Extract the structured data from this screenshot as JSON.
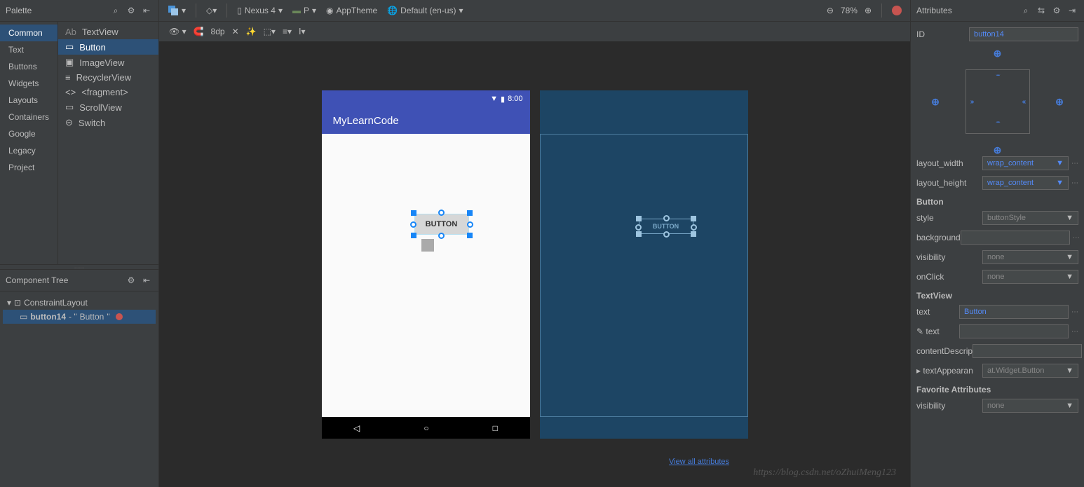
{
  "palette": {
    "title": "Palette",
    "categories": [
      "Common",
      "Text",
      "Buttons",
      "Widgets",
      "Layouts",
      "Containers",
      "Google",
      "Legacy",
      "Project"
    ],
    "selectedCategory": "Common",
    "items": [
      "TextView",
      "Button",
      "ImageView",
      "RecyclerView",
      "<fragment>",
      "ScrollView",
      "Switch"
    ],
    "selectedItem": "Button"
  },
  "componentTree": {
    "title": "Component Tree",
    "root": "ConstraintLayout",
    "child": {
      "id": "button14",
      "text": "Button"
    }
  },
  "toolbar": {
    "device": "Nexus 4",
    "api": "P",
    "theme": "AppTheme",
    "locale": "Default (en-us)",
    "zoom": "78%",
    "margin": "8dp"
  },
  "device": {
    "time": "8:00",
    "appTitle": "MyLearnCode",
    "buttonLabel": "BUTTON"
  },
  "blueprint": {
    "buttonLabel": "BUTTON"
  },
  "viewAll": "View all attributes",
  "attributes": {
    "title": "Attributes",
    "id": {
      "label": "ID",
      "value": "button14"
    },
    "layout_width": {
      "label": "layout_width",
      "value": "wrap_content"
    },
    "layout_height": {
      "label": "layout_height",
      "value": "wrap_content"
    },
    "sections": {
      "button": "Button",
      "textview": "TextView",
      "favorite": "Favorite Attributes"
    },
    "style": {
      "label": "style",
      "value": "buttonStyle"
    },
    "background": {
      "label": "background",
      "value": ""
    },
    "visibility": {
      "label": "visibility",
      "value": "none"
    },
    "onClick": {
      "label": "onClick",
      "value": "none"
    },
    "text": {
      "label": "text",
      "value": "Button"
    },
    "text2": {
      "label": "text",
      "value": ""
    },
    "contentDescription": {
      "label": "contentDescrip",
      "value": ""
    },
    "textAppearance": {
      "label": "textAppearan",
      "value": "at.Widget.Button"
    },
    "favVisibility": {
      "label": "visibility",
      "value": "none"
    }
  },
  "watermark": "https://blog.csdn.net/oZhuiMeng123"
}
